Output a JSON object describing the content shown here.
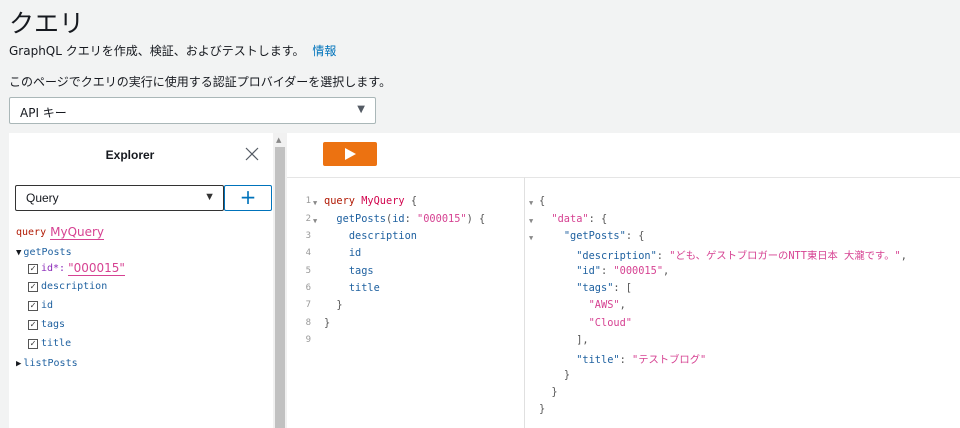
{
  "header": {
    "title": "クエリ",
    "description": "GraphQL クエリを作成、検証、およびテストします。",
    "info_link": "情報",
    "provider_label": "このページでクエリの実行に使用する認証プロバイダーを選択します。",
    "provider_value": "API キー"
  },
  "explorer": {
    "title": "Explorer",
    "operation_type": "Query",
    "add_label": "+",
    "query_keyword": "query",
    "operation_name": "MyQuery",
    "root_field": "getPosts",
    "arg_name": "id*:",
    "arg_value": "\"000015\"",
    "fields": [
      "description",
      "id",
      "tags",
      "title"
    ],
    "other_field": "listPosts"
  },
  "editor": {
    "line_numbers": [
      "1",
      "2",
      "3",
      "4",
      "5",
      "6",
      "7",
      "8",
      "9"
    ],
    "line1_kw": "query",
    "line1_name": "MyQuery",
    "line1_brace": "{",
    "line2_field": "getPosts",
    "line2_open": "(",
    "line2_arg": "id",
    "line2_colon": ": ",
    "line2_value": "\"000015\"",
    "line2_close": ") {",
    "line3": "description",
    "line4": "id",
    "line5": "tags",
    "line6": "title",
    "line7": "}",
    "line8": "}"
  },
  "result": {
    "open": "{",
    "data_key": "\"data\"",
    "getposts_key": "\"getPosts\"",
    "colon_brace": ": {",
    "description_key": "\"description\"",
    "description_value": "\"ども、ゲストブロガーのNTT東日本 大瀧です。\"",
    "id_key": "\"id\"",
    "id_value": "\"000015\"",
    "tags_key": "\"tags\"",
    "tags_open": ": [",
    "tag1": "\"AWS\"",
    "tag2": "\"Cloud\"",
    "tags_close": "],",
    "title_key": "\"title\"",
    "title_value": "\"テストブログ\"",
    "close_inner": "}",
    "close_data": "}",
    "close_root": "}",
    "colon": ": ",
    "comma": ","
  },
  "colors": {
    "run_button": "#ec7211",
    "link": "#0073bb",
    "string": "#d64292",
    "property": "#1f61a0"
  },
  "icons": {
    "close": "close-icon",
    "play": "play-icon",
    "dropdown": "chevron-down-icon"
  }
}
